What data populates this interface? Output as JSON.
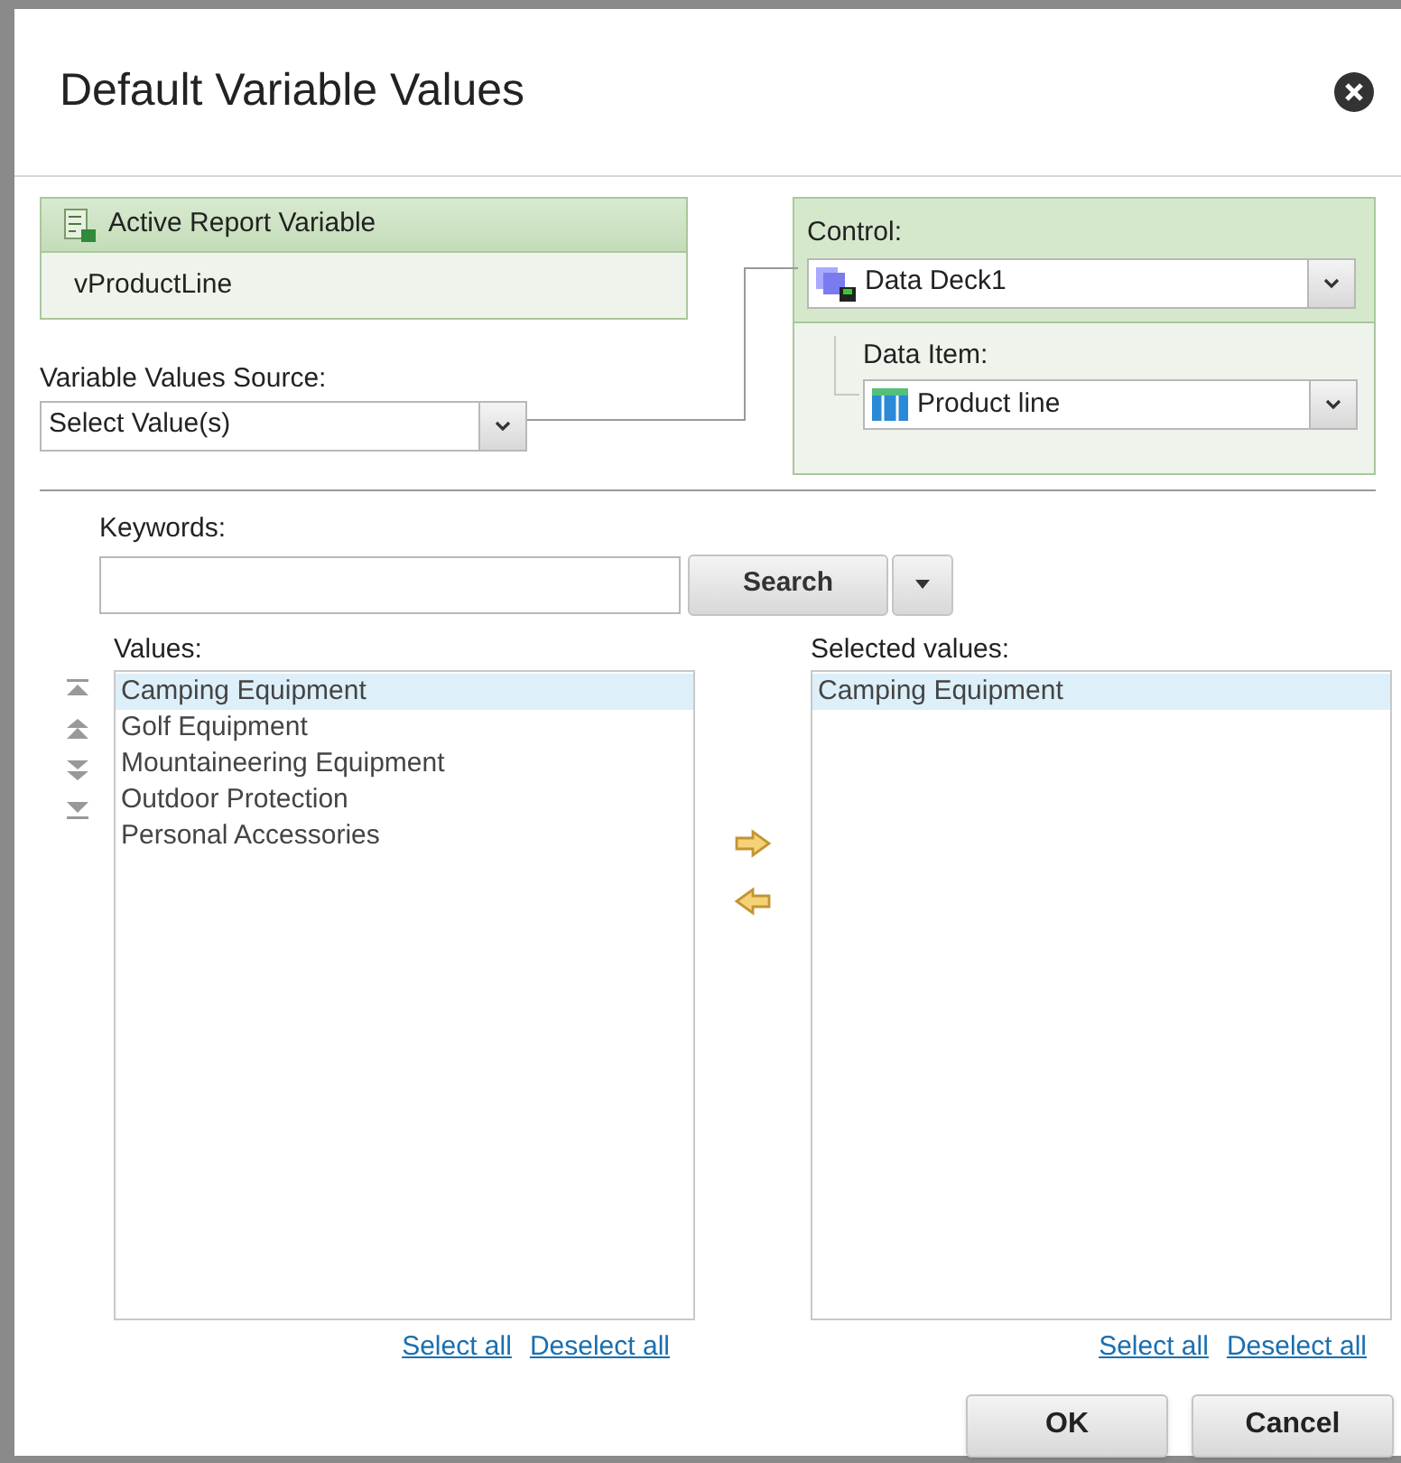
{
  "dialog": {
    "title": "Default Variable Values"
  },
  "variable_panel": {
    "header": "Active Report Variable",
    "value": "vProductLine"
  },
  "source": {
    "label": "Variable Values Source:",
    "value": "Select Value(s)"
  },
  "control": {
    "label": "Control:",
    "value": "Data Deck1"
  },
  "data_item": {
    "label": "Data Item:",
    "value": "Product line"
  },
  "keywords": {
    "label": "Keywords:",
    "search_button": "Search"
  },
  "values": {
    "label": "Values:",
    "items": [
      {
        "text": "Camping Equipment",
        "selected": true
      },
      {
        "text": "Golf Equipment",
        "selected": false
      },
      {
        "text": "Mountaineering Equipment",
        "selected": false
      },
      {
        "text": "Outdoor Protection",
        "selected": false
      },
      {
        "text": "Personal Accessories",
        "selected": false
      }
    ],
    "links": [
      "Select all",
      "Deselect all"
    ]
  },
  "selected_values": {
    "label": "Selected values:",
    "items": [
      {
        "text": "Camping Equipment",
        "selected": true
      }
    ],
    "links": [
      "Select all",
      "Deselect all"
    ]
  },
  "buttons": [
    "OK",
    "Cancel"
  ]
}
